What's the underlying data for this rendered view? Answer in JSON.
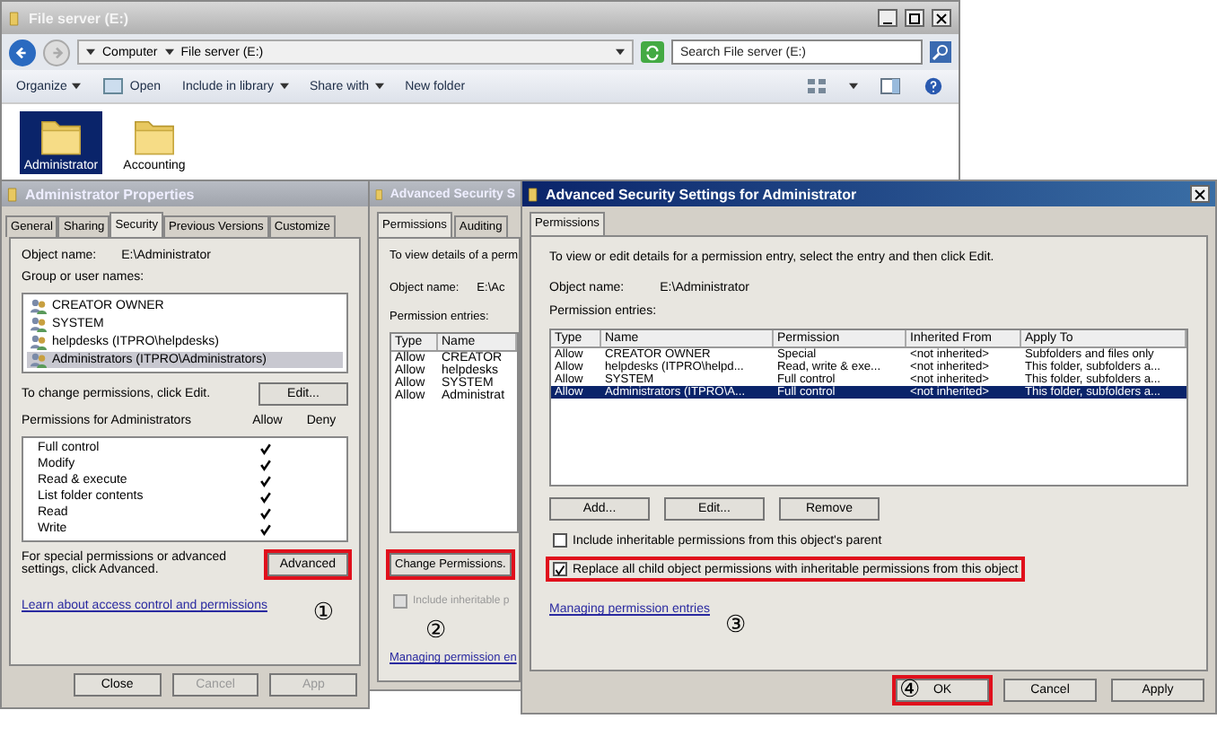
{
  "explorer": {
    "title": "File server (E:)",
    "breadcrumb": [
      "Computer",
      "File server (E:)"
    ],
    "search": {
      "placeholder": "Search File server (E:)"
    },
    "toolbar": [
      {
        "label": "Organize",
        "dropdown": true
      },
      {
        "label": "Open",
        "dropdown": false
      },
      {
        "label": "Include in library",
        "dropdown": true
      },
      {
        "label": "Share with",
        "dropdown": true
      },
      {
        "label": "New folder",
        "dropdown": false
      }
    ],
    "folders": [
      {
        "name": "Administrator",
        "selected": true
      },
      {
        "name": "Accounting",
        "selected": false
      }
    ]
  },
  "properties_dialog": {
    "title": "Administrator Properties",
    "tabs": [
      {
        "label": "General",
        "selected": false
      },
      {
        "label": "Sharing",
        "selected": false
      },
      {
        "label": "Security",
        "selected": true
      },
      {
        "label": "Previous Versions",
        "selected": false
      },
      {
        "label": "Customize",
        "selected": false
      }
    ],
    "object_label": "Object name:",
    "object_value": "E:\\Administrator",
    "groups_label": "Group or user names:",
    "groups": [
      {
        "name": "CREATOR OWNER",
        "selected": false
      },
      {
        "name": "SYSTEM",
        "selected": false
      },
      {
        "name": "helpdesks (ITPRO\\helpdesks)",
        "selected": false
      },
      {
        "name": "Administrators (ITPRO\\Administrators)",
        "selected": true
      }
    ],
    "change_hint": "To change permissions, click Edit.",
    "edit_button": "Edit...",
    "permissions_label": "Permissions for Administrators",
    "allow_label": "Allow",
    "deny_label": "Deny",
    "permissions": [
      {
        "name": "Full control",
        "allow": true
      },
      {
        "name": "Modify",
        "allow": true
      },
      {
        "name": "Read & execute",
        "allow": true
      },
      {
        "name": "List folder contents",
        "allow": true
      },
      {
        "name": "Read",
        "allow": true
      },
      {
        "name": "Write",
        "allow": true
      }
    ],
    "advanced_hint": "For special permissions or advanced settings, click Advanced.",
    "advanced_button": {
      "label": "Advanced",
      "highlighted": true
    },
    "step": "①",
    "link": "Learn about access control and permissions",
    "buttons": [
      {
        "label": "Close",
        "disabled": false
      },
      {
        "label": "Cancel",
        "disabled": true
      },
      {
        "label": "App",
        "disabled": true
      }
    ]
  },
  "advanced_dialog_behind": {
    "title": "Advanced Security S",
    "tabs": [
      {
        "label": "Permissions",
        "selected": true
      },
      {
        "label": "Auditing",
        "selected": false
      }
    ],
    "intro": "To view details of a perm",
    "object_label": "Object name:",
    "object_value": "E:\\Ac",
    "entries_label": "Permission entries:",
    "columns": [
      "Type",
      "Name"
    ],
    "rows": [
      {
        "type": "Allow",
        "name": "CREATOR"
      },
      {
        "type": "Allow",
        "name": "helpdesks"
      },
      {
        "type": "Allow",
        "name": "SYSTEM"
      },
      {
        "type": "Allow",
        "name": "Administrat"
      }
    ],
    "change_button": {
      "label": "Change Permissions.",
      "highlighted": true
    },
    "step": "②",
    "inherit_checkbox": {
      "label": "Include inheritable p",
      "checked": false,
      "disabled": true
    },
    "link": "Managing permission en"
  },
  "advanced_dialog": {
    "title": "Advanced Security Settings for Administrator",
    "tabs": [
      {
        "label": "Permissions",
        "selected": true
      }
    ],
    "intro": "To view or edit details for a permission entry, select the entry and then click Edit.",
    "object_label": "Object name:",
    "object_value": "E:\\Administrator",
    "entries_label": "Permission entries:",
    "columns": [
      "Type",
      "Name",
      "Permission",
      "Inherited From",
      "Apply To"
    ],
    "rows": [
      {
        "cells": [
          "Allow",
          "CREATOR OWNER",
          "Special",
          "<not inherited>",
          "Subfolders and files only"
        ],
        "selected": false
      },
      {
        "cells": [
          "Allow",
          "helpdesks (ITPRO\\helpd...",
          "Read, write & exe...",
          "<not inherited>",
          "This folder, subfolders a..."
        ],
        "selected": false
      },
      {
        "cells": [
          "Allow",
          "SYSTEM",
          "Full control",
          "<not inherited>",
          "This folder, subfolders a..."
        ],
        "selected": false
      },
      {
        "cells": [
          "Allow",
          "Administrators (ITPRO\\A...",
          "Full control",
          "<not inherited>",
          "This folder, subfolders a..."
        ],
        "selected": true
      }
    ],
    "entry_buttons": [
      "Add...",
      "Edit...",
      "Remove"
    ],
    "checkboxes": [
      {
        "label": "Include inheritable permissions from this object's parent",
        "checked": false,
        "highlighted": false
      },
      {
        "label": "Replace all child object permissions with inheritable permissions from this object",
        "checked": true,
        "highlighted": true
      }
    ],
    "step_checkbox": "③",
    "link": "Managing permission entries",
    "buttons": [
      {
        "label": "OK",
        "highlighted": true
      },
      {
        "label": "Cancel",
        "highlighted": false
      },
      {
        "label": "Apply",
        "highlighted": false
      }
    ],
    "step_ok": "④"
  }
}
